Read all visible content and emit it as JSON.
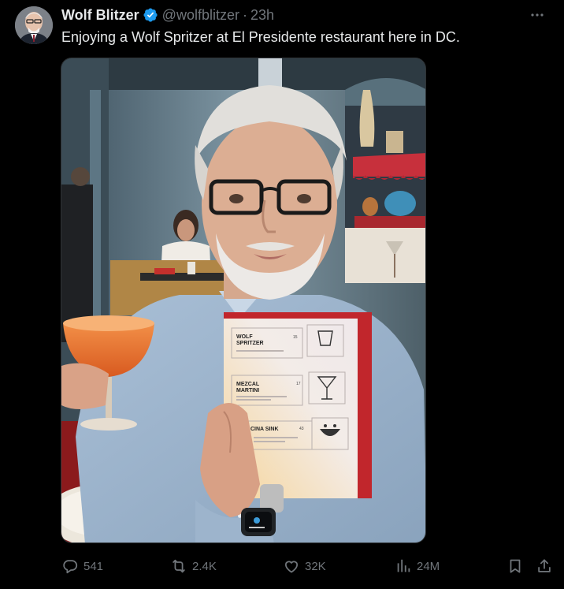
{
  "author": {
    "display_name": "Wolf Blitzer",
    "handle": "@wolfblitzer",
    "separator": "·",
    "time": "23h",
    "verified_icon": "verified-badge-icon"
  },
  "tweet": {
    "text": "Enjoying a Wolf Spritzer at El Presidente restaurant here in DC."
  },
  "menu_card": {
    "item1_name_line1": "WOLF",
    "item1_name_line2": "SPRITZER",
    "item1_price": "15",
    "item2_name_line1": "MEZCAL",
    "item2_name_line2": "MARTINI",
    "item2_price": "17",
    "item3_name": "CINA SINK",
    "item3_price": "43"
  },
  "actions": {
    "replies": "541",
    "reposts": "2.4K",
    "likes": "32K",
    "views": "24M"
  },
  "colors": {
    "background": "#000000",
    "text_primary": "#e7e9ea",
    "text_secondary": "#71767b",
    "verified": "#1d9bf0"
  }
}
